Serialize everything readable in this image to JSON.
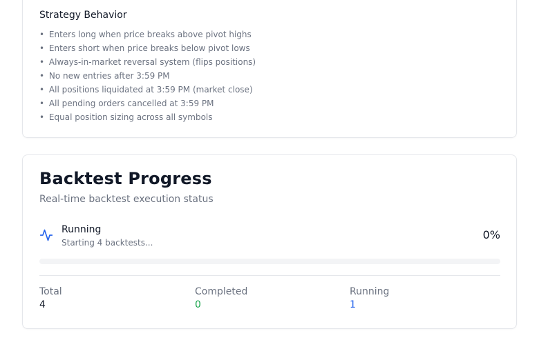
{
  "strategy": {
    "title": "Strategy Behavior",
    "bullet": "•",
    "rules": [
      "Enters long when price breaks above pivot highs",
      "Enters short when price breaks below pivot lows",
      "Always-in-market reversal system (flips positions)",
      "No new entries after 3:59 PM",
      "All positions liquidated at 3:59 PM (market close)",
      "All pending orders cancelled at 3:59 PM",
      "Equal position sizing across all symbols"
    ]
  },
  "progress": {
    "title": "Backtest Progress",
    "subtitle": "Real-time backtest execution status",
    "status_icon": "activity-icon",
    "status_label": "Running",
    "status_detail": "Starting 4 backtests...",
    "percent_text": "0%",
    "progress_fraction": 0,
    "stats": {
      "total_label": "Total",
      "total_value": "4",
      "completed_label": "Completed",
      "completed_value": "0",
      "running_label": "Running",
      "running_value": "1"
    }
  },
  "colors": {
    "accent": "#2563eb",
    "success": "#16a34a",
    "muted_text": "#6b7280",
    "border": "#e5e7eb"
  }
}
